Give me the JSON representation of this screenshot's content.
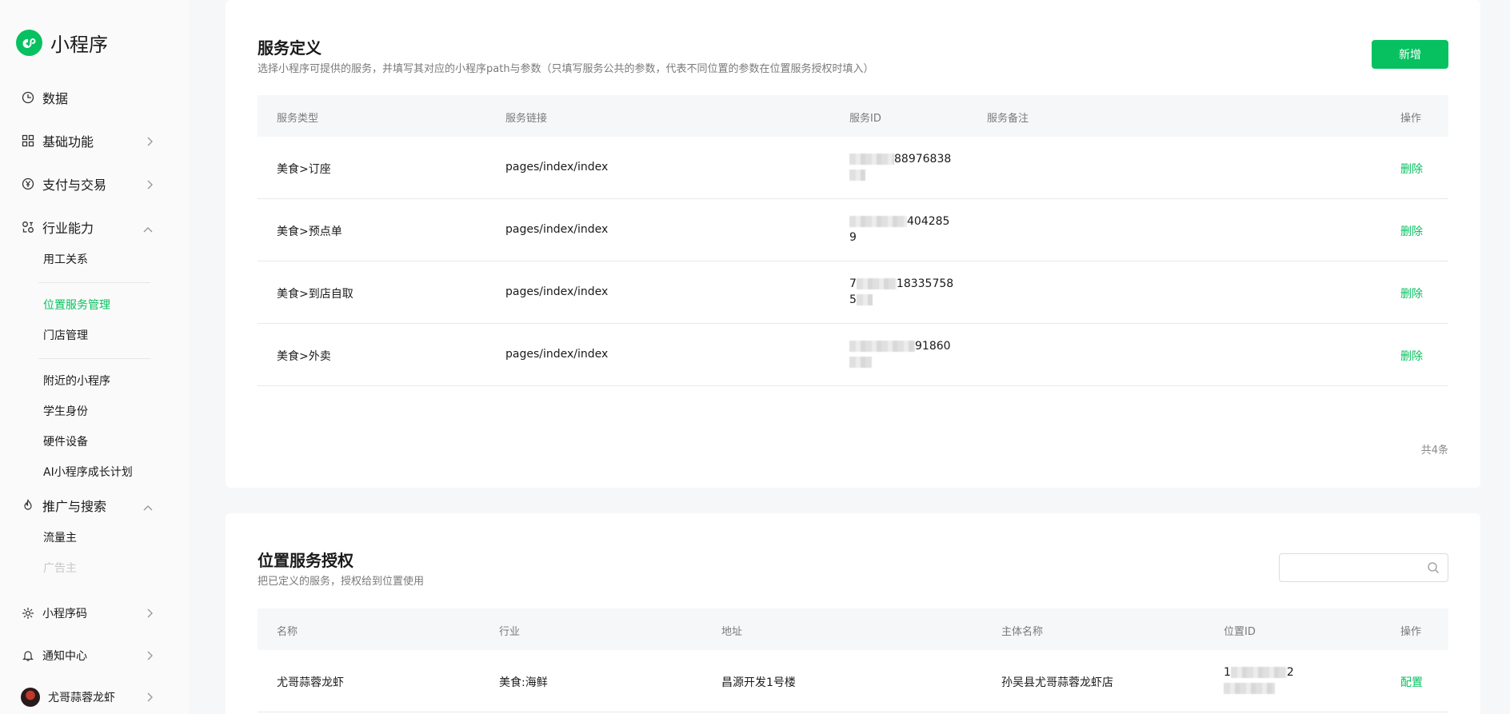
{
  "brand": {
    "name": "小程序"
  },
  "sidebar": {
    "items": [
      {
        "label": "数据",
        "icon": "clock-icon"
      },
      {
        "label": "基础功能",
        "icon": "grid-icon"
      },
      {
        "label": "支付与交易",
        "icon": "yen-icon"
      },
      {
        "label": "行业能力",
        "icon": "industry-icon"
      },
      {
        "label": "推广与搜索",
        "icon": "flame-icon"
      },
      {
        "label": "小程序码",
        "icon": "sun-icon"
      },
      {
        "label": "通知中心",
        "icon": "bell-icon"
      },
      {
        "label": "尤哥蒜蓉龙虾",
        "icon": "avatar"
      }
    ],
    "industry_sub": [
      "用工关系",
      "位置服务管理",
      "门店管理",
      "附近的小程序",
      "学生身份",
      "硬件设备",
      "AI小程序成长计划"
    ],
    "promo_sub": [
      "流量主",
      "广告主"
    ]
  },
  "service_def": {
    "title": "服务定义",
    "desc": "选择小程序可提供的服务，并填写其对应的小程序path与参数（只填写服务公共的参数，代表不同位置的参数在位置服务授权时填入）",
    "add_label": "新增",
    "columns": [
      "服务类型",
      "服务链接",
      "服务ID",
      "服务备注",
      "操作"
    ],
    "rows": [
      {
        "type": "美食>订座",
        "link": "pages/index/index",
        "id_visible": "88976838",
        "note": "",
        "op": "删除"
      },
      {
        "type": "美食>预点单",
        "link": "pages/index/index",
        "id_visible": "404285",
        "id_line2": "9",
        "note": "",
        "op": "删除"
      },
      {
        "type": "美食>到店自取",
        "link": "pages/index/index",
        "id_prefix": "7",
        "id_visible": "18335758",
        "id_line2": "5",
        "note": "",
        "op": "删除"
      },
      {
        "type": "美食>外卖",
        "link": "pages/index/index",
        "id_visible": "91860",
        "note": "",
        "op": "删除"
      }
    ],
    "total": "共4条"
  },
  "location_auth": {
    "title": "位置服务授权",
    "desc": "把已定义的服务，授权给到位置使用",
    "search_placeholder": "",
    "columns": [
      "名称",
      "行业",
      "地址",
      "主体名称",
      "位置ID",
      "操作"
    ],
    "rows": [
      {
        "name": "尤哥蒜蓉龙虾",
        "industry": "美食:海鲜",
        "address": "昌源开发1号楼",
        "entity": "孙吴县尤哥蒜蓉龙虾店",
        "id_prefix": "1",
        "id_suffix": "2",
        "op": "配置"
      }
    ]
  },
  "colors": {
    "accent": "#07c160",
    "bg": "#f6f7f8"
  }
}
